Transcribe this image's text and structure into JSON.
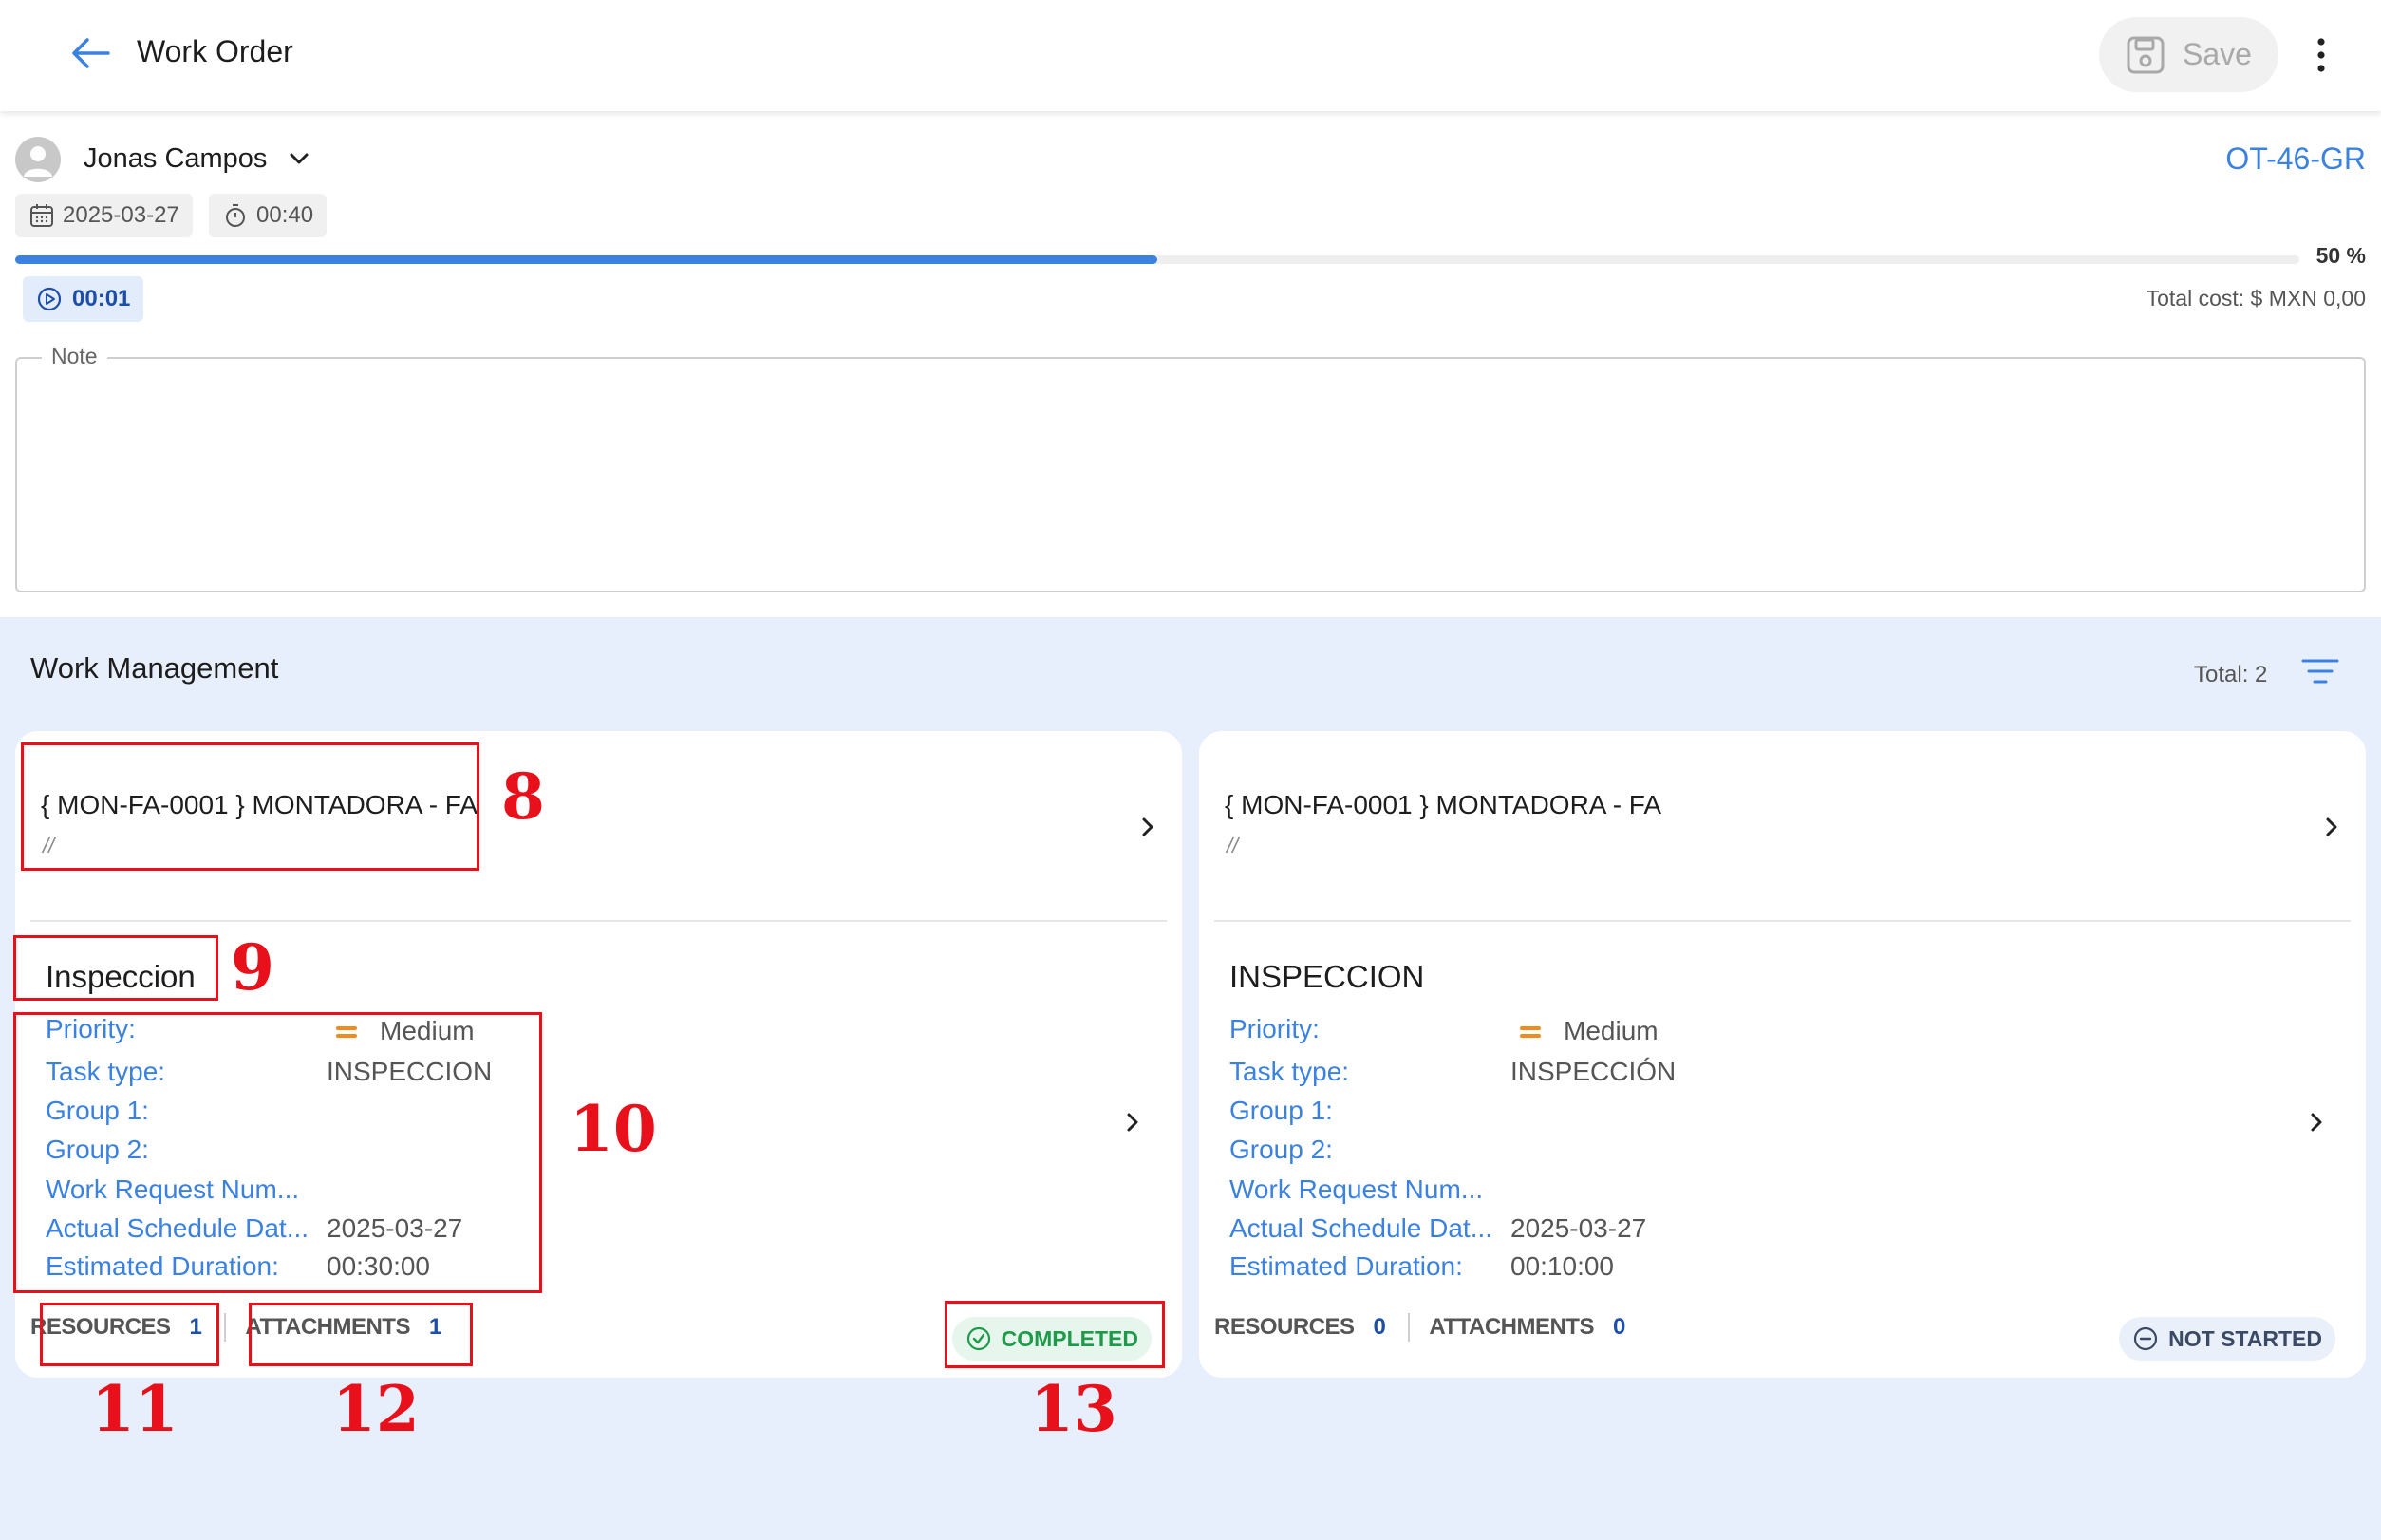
{
  "topbar": {
    "title": "Work Order",
    "save_label": "Save"
  },
  "header": {
    "user_name": "Jonas Campos",
    "work_order_code": "OT-46-GR",
    "date": "2025-03-27",
    "duration": "00:40",
    "progress_percent": 50,
    "progress_label": "50 %",
    "timer": "00:01",
    "total_cost": "Total cost: $ MXN 0,00",
    "note_label": "Note",
    "note_value": ""
  },
  "work_management": {
    "title": "Work Management",
    "total": "Total: 2",
    "cards": [
      {
        "asset_title": "{ MON-FA-0001 } MONTADORA - FA",
        "asset_sub": "//",
        "task_title": "Inspeccion",
        "fields": {
          "priority_label": "Priority:",
          "priority_value": "Medium",
          "task_type_label": "Task type:",
          "task_type_value": "INSPECCION",
          "group1_label": "Group 1:",
          "group2_label": "Group 2:",
          "work_request_label": "Work Request Num...",
          "actual_schedule_label": "Actual Schedule Dat...",
          "actual_schedule_value": "2025-03-27",
          "estimated_duration_label": "Estimated Duration:",
          "estimated_duration_value": "00:30:00"
        },
        "resources_label": "RESOURCES",
        "resources_count": "1",
        "attachments_label": "ATTACHMENTS",
        "attachments_count": "1",
        "status": "COMPLETED"
      },
      {
        "asset_title": "{ MON-FA-0001 } MONTADORA - FA",
        "asset_sub": "//",
        "task_title": "INSPECCION",
        "fields": {
          "priority_label": "Priority:",
          "priority_value": "Medium",
          "task_type_label": "Task type:",
          "task_type_value": "INSPECCIÓN",
          "group1_label": "Group 1:",
          "group2_label": "Group 2:",
          "work_request_label": "Work Request Num...",
          "actual_schedule_label": "Actual Schedule Dat...",
          "actual_schedule_value": "2025-03-27",
          "estimated_duration_label": "Estimated Duration:",
          "estimated_duration_value": "00:10:00"
        },
        "resources_label": "RESOURCES",
        "resources_count": "0",
        "attachments_label": "ATTACHMENTS",
        "attachments_count": "0",
        "status": "NOT STARTED"
      }
    ]
  },
  "annotations": [
    "8",
    "9",
    "10",
    "11",
    "12",
    "13"
  ],
  "colors": {
    "accent": "#3b82e0",
    "page_background": "#e8effc",
    "completed": "#1f9a4a",
    "priority_medium": "#f08c1e",
    "annotation": "#e8101a"
  },
  "icons": {
    "back": "arrow-left-icon",
    "save": "floppy-disk-icon",
    "more": "vertical-dots-icon",
    "user": "avatar-person-icon",
    "calendar": "calendar-icon",
    "stopwatch": "stopwatch-icon",
    "play": "play-circle-icon",
    "filter": "filter-lines-icon",
    "chevron": "chevron-right-icon",
    "completed": "check-circle-icon",
    "not_started": "minus-circle-icon"
  }
}
